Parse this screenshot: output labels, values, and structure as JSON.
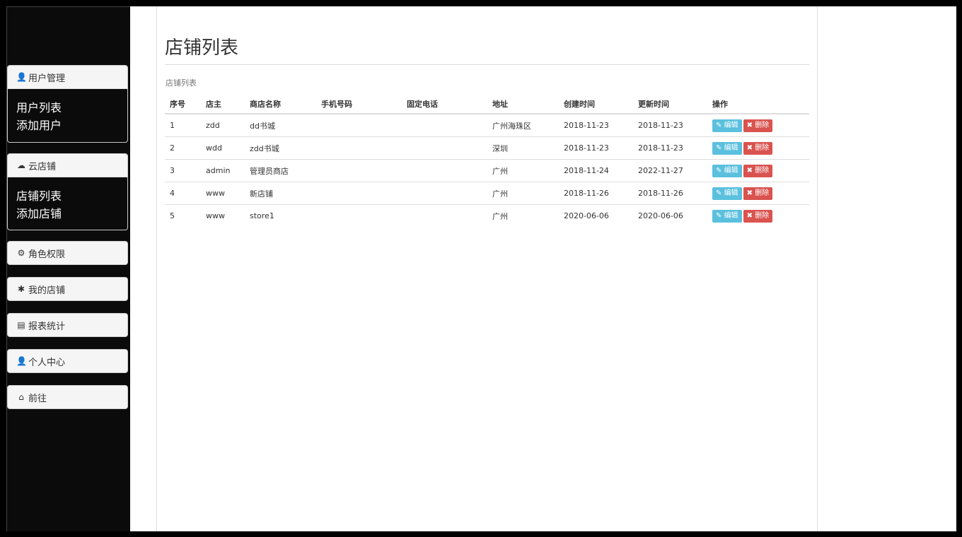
{
  "sidebar": {
    "user_panel": {
      "title": "用户管理",
      "icon": "user-icon",
      "links": [
        "用户列表",
        "添加用户"
      ]
    },
    "cloud_panel": {
      "title": "云店铺",
      "icon": "cloud-icon",
      "links": [
        "店铺列表",
        "添加店铺"
      ]
    },
    "buttons": [
      {
        "label": "角色权限",
        "icon": "gear-icon"
      },
      {
        "label": "我的店铺",
        "icon": "asterisk-icon"
      },
      {
        "label": "报表统计",
        "icon": "list-icon"
      },
      {
        "label": "个人中心",
        "icon": "user-icon"
      },
      {
        "label": "前往",
        "icon": "home-icon"
      }
    ]
  },
  "main": {
    "title": "店铺列表",
    "caption": "店铺列表",
    "table": {
      "headers": [
        "序号",
        "店主",
        "商店名称",
        "手机号码",
        "固定电话",
        "地址",
        "创建时间",
        "更新时间",
        "操作"
      ],
      "rows": [
        [
          "1",
          "zdd",
          "dd书城",
          "",
          "",
          "广州海珠区",
          "2018-11-23",
          "2018-11-23"
        ],
        [
          "2",
          "wdd",
          "zdd书城",
          "",
          "",
          "深圳",
          "2018-11-23",
          "2018-11-23"
        ],
        [
          "3",
          "admin",
          "管理员商店",
          "",
          "",
          "广州",
          "2018-11-24",
          "2022-11-27"
        ],
        [
          "4",
          "www",
          "新店铺",
          "",
          "",
          "广州",
          "2018-11-26",
          "2018-11-26"
        ],
        [
          "5",
          "www",
          "store1",
          "",
          "",
          "广州",
          "2020-06-06",
          "2020-06-06"
        ]
      ],
      "edit_label": "编辑",
      "delete_label": "删除"
    }
  },
  "colors": {
    "edit": "#5bc0de",
    "delete": "#d9534f",
    "sidebar_bg": "#0b0b0b"
  }
}
